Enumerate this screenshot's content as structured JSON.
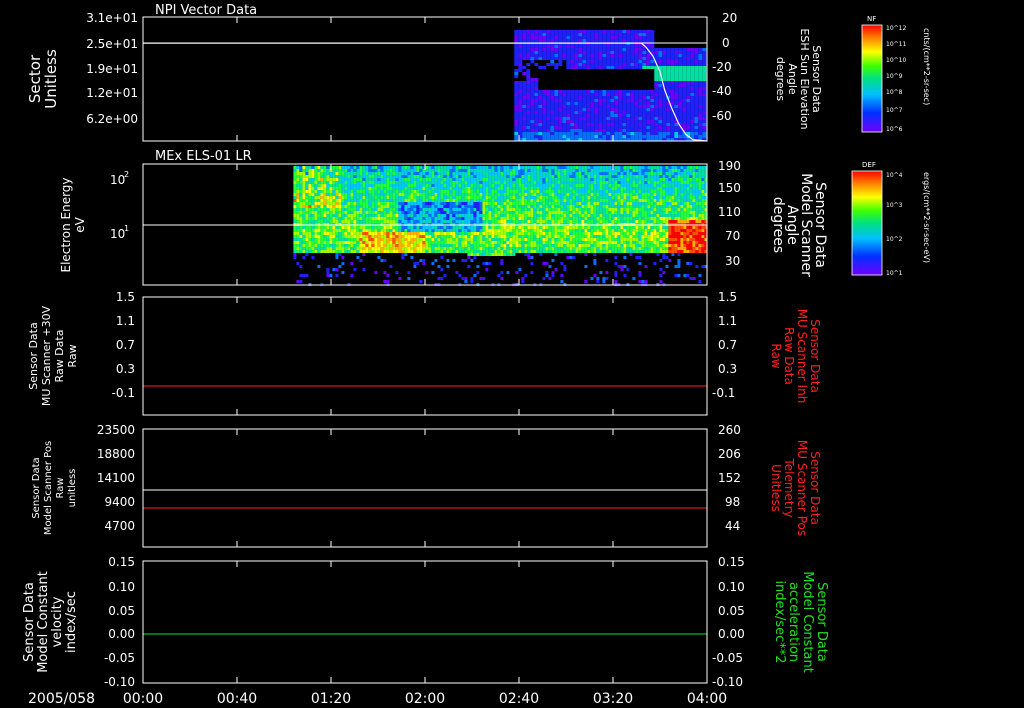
{
  "chart_data": [
    {
      "type": "heatmap",
      "title": "NPI Vector Data",
      "ylabel": [
        "Sector",
        "Unitless"
      ],
      "y_ticks": [
        "3.1e+01",
        "2.5e+01",
        "1.9e+01",
        "1.2e+01",
        "6.2e+00"
      ],
      "y2label": [
        "Sensor Data",
        "ESH Sun Elevation",
        "Angle",
        "degrees"
      ],
      "y2_ticks": [
        "20",
        "0",
        "-20",
        "-40",
        "-60"
      ],
      "y2lim": [
        -75,
        20
      ],
      "colorbar": {
        "label": "NF",
        "unit": "cnts/(cm**2-sr-sec)",
        "ticks": [
          "10^12",
          "10^11",
          "10^10",
          "10^9",
          "10^8",
          "10^7",
          "10^6"
        ]
      },
      "reference_line": {
        "y": 25,
        "color": "#ffffff"
      },
      "series": [
        {
          "x_minutes": [
            0,
            212,
            214,
            217,
            220,
            222,
            225,
            228,
            231,
            234,
            240
          ],
          "values": [
            0,
            0,
            -3,
            -10,
            -22,
            -36,
            -50,
            -62,
            -70,
            -74,
            -75
          ],
          "color": "#ffffff"
        }
      ]
    },
    {
      "type": "heatmap",
      "title": "MEx ELS-01 LR",
      "ylabel": [
        "Electron Energy",
        "eV"
      ],
      "y_ticks": [
        "10^2",
        "10^1"
      ],
      "y2label": [
        "Sensor Data",
        "Model Scanner",
        "Angle",
        "degrees"
      ],
      "y2_ticks": [
        "190",
        "150",
        "110",
        "70",
        "30"
      ],
      "y2lim": [
        10,
        190
      ],
      "colorbar": {
        "label": "DEF",
        "unit": "ergs/(cm**2-sr-sec-eV)",
        "ticks": [
          "10^4",
          "10^3",
          "10^2",
          "10^1"
        ]
      },
      "series": [
        {
          "x_minutes": [
            0,
            240
          ],
          "values": [
            85,
            85
          ],
          "color": "#ffffff"
        }
      ]
    },
    {
      "type": "line",
      "ylabel": [
        "Sensor Data",
        "MU Scanner +30V",
        "Raw Data",
        "Raw"
      ],
      "y_ticks": [
        "1.5",
        "1.1",
        "0.7",
        "0.3",
        "-0.1"
      ],
      "ylim": [
        -0.5,
        1.5
      ],
      "y2label": [
        "Sensor Data",
        "MU Scanner Inh",
        "Raw Data",
        "Raw"
      ],
      "y2_ticks": [
        "1.5",
        "1.1",
        "0.7",
        "0.3",
        "-0.1"
      ],
      "series": [
        {
          "x_minutes": [
            0,
            240
          ],
          "values": [
            0.0,
            0.0
          ],
          "color": "#ff2020"
        }
      ]
    },
    {
      "type": "line",
      "ylabel": [
        "Sensor Data",
        "Model Scanner Pos",
        "Raw",
        "unitless"
      ],
      "y_ticks": [
        "23500",
        "18800",
        "14100",
        "9400",
        "4700"
      ],
      "ylim": [
        0,
        23500
      ],
      "y2label": [
        "Sensor Data",
        "MU Scanner Pos",
        "Telemetry",
        "Unitless"
      ],
      "y2_ticks": [
        "260",
        "206",
        "152",
        "98",
        "44"
      ],
      "y2lim": [
        -10,
        260
      ],
      "series": [
        {
          "x_minutes": [
            0,
            240
          ],
          "values": [
            11500,
            11500
          ],
          "color": "#ffffff"
        },
        {
          "x_minutes": [
            0,
            240
          ],
          "values": [
            8200,
            8200
          ],
          "color": "#ff2020"
        }
      ]
    },
    {
      "type": "line",
      "ylabel": [
        "Sensor Data",
        "Model Constant",
        "velocity",
        "index/sec"
      ],
      "y_ticks": [
        "0.15",
        "0.10",
        "0.05",
        "0.00",
        "-0.05",
        "-0.10"
      ],
      "ylim": [
        -0.1,
        0.15
      ],
      "y2label": [
        "Sensor Data",
        "Model Constant",
        "acceleration",
        "index/sec**2"
      ],
      "y2_ticks": [
        "0.15",
        "0.10",
        "0.05",
        "0.00",
        "-0.05",
        "-0.10"
      ],
      "series": [
        {
          "x_minutes": [
            0,
            240
          ],
          "values": [
            0.0,
            0.0
          ],
          "color": "#20e020"
        }
      ]
    }
  ],
  "x_axis": {
    "date_label": "2005/058",
    "ticks": [
      "00:00",
      "00:40",
      "01:20",
      "02:00",
      "02:40",
      "03:20",
      "04:00"
    ],
    "range_minutes": [
      0,
      240
    ]
  }
}
